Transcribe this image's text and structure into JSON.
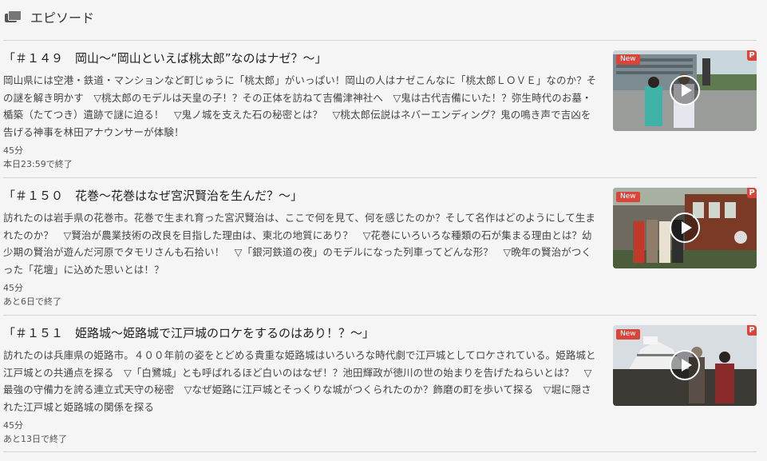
{
  "header": {
    "icon": "stack-icon",
    "title": "エピソード"
  },
  "episodes": [
    {
      "title": "「＃１４９　岡山～“岡山といえば桃太郎”なのはナゼ？～」",
      "description": "岡山県には空港・鉄道・マンションなど町じゅうに「桃太郎」がいっぱい！岡山の人はナゼこんなに「桃太郎ＬＯＶＥ」なのか？その謎を解き明かす　▽桃太郎のモデルは天皇の子！？その正体を訪ねて吉備津神社へ　▽鬼は古代吉備にいた！？弥生時代のお墓・楯築（たてつき）遺跡で謎に迫る！　▽鬼ノ城を支えた石の秘密とは？　▽桃太郎伝説はネバーエンディング？鬼の鳴き声で吉凶を告げる神事を林田アナウンサーが体験！",
      "duration": "45分",
      "expiry": "本日23:59で終了",
      "badge_new": "New",
      "badge_p": "P",
      "thumbnail_icon": "play-icon"
    },
    {
      "title": "「＃１５０　花巻～花巻はなぜ宮沢賢治を生んだ？～」",
      "description": "訪れたのは岩手県の花巻市。花巻で生まれ育った宮沢賢治は、ここで何を見て、何を感じたのか？そして名作はどのようにして生まれたのか？　▽賢治が農業技術の改良を目指した理由は、東北の地質にあり？　▽花巻にいろいろな種類の石が集まる理由とは？幼少期の賢治が遊んだ河原でタモリさんも石拾い！　▽「銀河鉄道の夜」のモデルになった列車ってどんな形？　▽晩年の賢治がつくった「花壇」に込めた思いとは！？",
      "duration": "45分",
      "expiry": "あと6日で終了",
      "badge_new": "New",
      "badge_p": "P",
      "thumbnail_icon": "play-icon"
    },
    {
      "title": "「＃１５１　姫路城～姫路城で江戸城のロケをするのはあり！？～」",
      "description": "訪れたのは兵庫県の姫路市。４００年前の姿をとどめる貴重な姫路城はいろいろな時代劇で江戸城としてロケされている。姫路城と江戸城との共通点を探る　▽「白鷺城」とも呼ばれるほど白いのはなぜ！？池田輝政が徳川の世の始まりを告げたねらいとは？　▽最強の守備力を誇る連立式天守の秘密　▽なぜ姫路に江戸城とそっくりな城がつくられたのか？飾磨の町を歩いて探る　▽堀に隠された江戸城と姫路城の関係を探る",
      "duration": "45分",
      "expiry": "あと13日で終了",
      "badge_new": "New",
      "badge_p": "P",
      "thumbnail_icon": "play-icon"
    }
  ]
}
